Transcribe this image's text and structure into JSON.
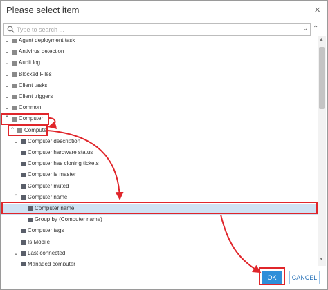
{
  "dialog": {
    "title": "Please select item",
    "close_symbol": "×"
  },
  "search": {
    "placeholder": "Type to search ...",
    "value": ""
  },
  "toolbar": {
    "expand_all_symbol": "⌄",
    "collapse_all_symbol": "⌃"
  },
  "tree": {
    "items": [
      {
        "label": "Agent deployment task",
        "level": 0,
        "state": "collapsed"
      },
      {
        "label": "Antivirus detection",
        "level": 0,
        "state": "collapsed"
      },
      {
        "label": "Audit log",
        "level": 0,
        "state": "collapsed"
      },
      {
        "label": "Blocked Files",
        "level": 0,
        "state": "collapsed"
      },
      {
        "label": "Client tasks",
        "level": 0,
        "state": "collapsed"
      },
      {
        "label": "Client triggers",
        "level": 0,
        "state": "collapsed"
      },
      {
        "label": "Common",
        "level": 0,
        "state": "collapsed"
      },
      {
        "label": "Computer",
        "level": 0,
        "state": "expanded"
      },
      {
        "label": "Computer",
        "level": 1,
        "state": "expanded"
      },
      {
        "label": "Computer description",
        "level": 2,
        "state": "collapsed"
      },
      {
        "label": "Computer hardware status",
        "level": 2,
        "state": "leaf"
      },
      {
        "label": "Computer has cloning tickets",
        "level": 2,
        "state": "leaf"
      },
      {
        "label": "Computer is master",
        "level": 2,
        "state": "leaf"
      },
      {
        "label": "Computer muted",
        "level": 2,
        "state": "leaf"
      },
      {
        "label": "Computer name",
        "level": 2,
        "state": "expanded"
      },
      {
        "label": "Computer name",
        "level": 3,
        "state": "leaf",
        "selected": true
      },
      {
        "label": "Group by (Computer name)",
        "level": 3,
        "state": "leaf"
      },
      {
        "label": "Computer tags",
        "level": 2,
        "state": "leaf"
      },
      {
        "label": "Is Mobile",
        "level": 2,
        "state": "leaf"
      },
      {
        "label": "Last connected",
        "level": 2,
        "state": "collapsed"
      },
      {
        "label": "Managed computer",
        "level": 2,
        "state": "leaf"
      }
    ]
  },
  "buttons": {
    "ok": "OK",
    "cancel": "CANCEL"
  },
  "colors": {
    "accent": "#2f8fd9",
    "annotation": "#e0262b",
    "selection": "#cfe2f3"
  }
}
